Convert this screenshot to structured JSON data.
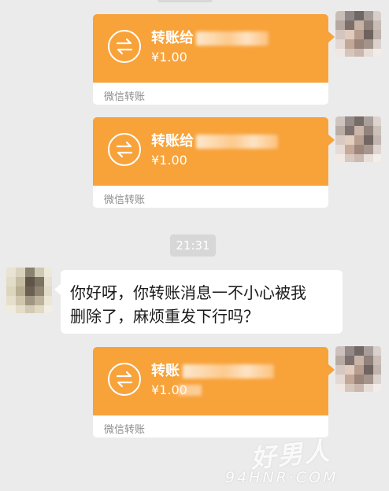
{
  "chat": {
    "transfers": [
      {
        "title": "转账给",
        "amount": "¥1.00",
        "footer": "微信转账"
      },
      {
        "title": "转账给",
        "amount": "¥1.00",
        "footer": "微信转账"
      },
      {
        "title": "转账",
        "amount": "¥1.00",
        "footer": "微信转账"
      }
    ],
    "timestamp": "21:31",
    "incoming_message": {
      "line1": "你好呀，你转账消息一不小心被我",
      "line2": "删除了，麻烦重发下行吗？"
    }
  },
  "watermark": {
    "chinese": "好男人",
    "domain": "94HNR·COM"
  },
  "colors": {
    "background": "#ebebeb",
    "transfer_orange": "#f8a23a",
    "bubble_white": "#ffffff",
    "timestamp_bg": "#d7d7d7",
    "footer_text": "#8c8c8c"
  },
  "icons": [
    "transfer-arrows-icon",
    "avatar-self",
    "avatar-contact"
  ]
}
